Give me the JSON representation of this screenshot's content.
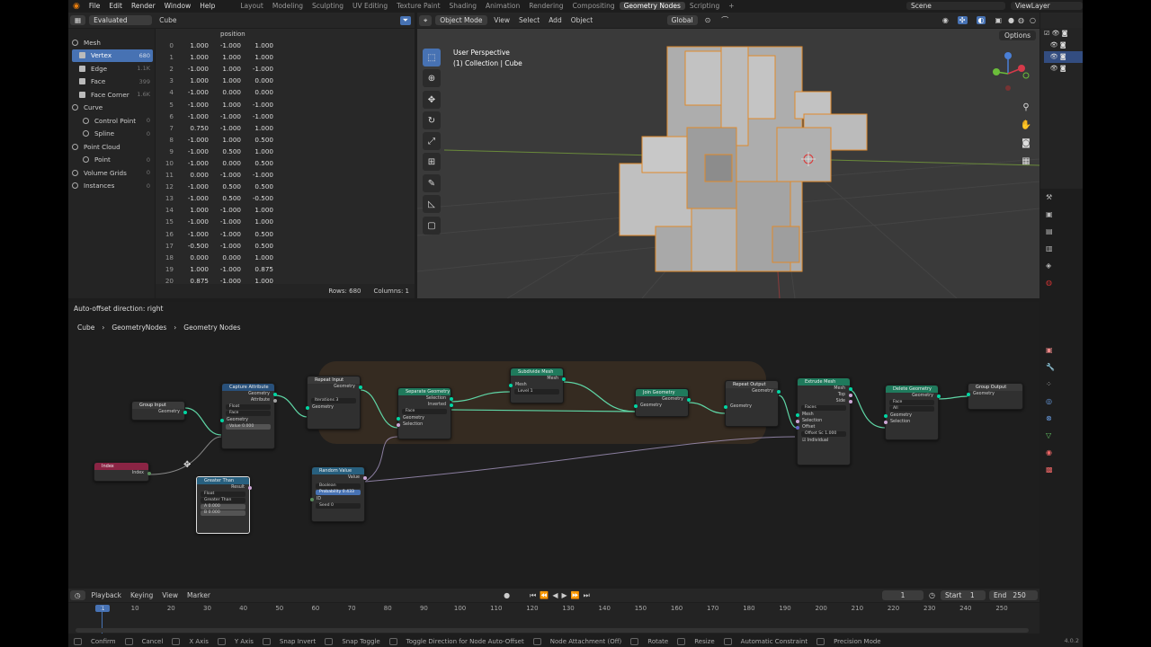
{
  "menu": {
    "items": [
      "File",
      "Edit",
      "Render",
      "Window",
      "Help"
    ],
    "workspaces": [
      "Layout",
      "Modeling",
      "Sculpting",
      "UV Editing",
      "Texture Paint",
      "Shading",
      "Animation",
      "Rendering",
      "Compositing",
      "Geometry Nodes",
      "Scripting"
    ],
    "active_workspace": "Geometry Nodes",
    "plus": "+",
    "scene": "Scene",
    "view_layer": "ViewLayer"
  },
  "spreadsheet": {
    "mode": "Evaluated",
    "object": "Cube",
    "column_header": "position",
    "tree": [
      {
        "label": "Mesh",
        "kind": "group"
      },
      {
        "label": "Vertex",
        "count": "680",
        "selected": true
      },
      {
        "label": "Edge",
        "count": "1.1K"
      },
      {
        "label": "Face",
        "count": "399"
      },
      {
        "label": "Face Corner",
        "count": "1.6K"
      },
      {
        "label": "Curve",
        "kind": "group"
      },
      {
        "label": "Control Point",
        "count": "0"
      },
      {
        "label": "Spline",
        "count": "0"
      },
      {
        "label": "Point Cloud",
        "kind": "group"
      },
      {
        "label": "Point",
        "count": "0"
      },
      {
        "label": "Volume Grids",
        "count": "0",
        "kind": "group"
      },
      {
        "label": "Instances",
        "count": "0",
        "kind": "group"
      }
    ],
    "rows": [
      [
        "0",
        "1.000",
        "-1.000",
        "1.000"
      ],
      [
        "1",
        "1.000",
        "1.000",
        "1.000"
      ],
      [
        "2",
        "-1.000",
        "1.000",
        "-1.000"
      ],
      [
        "3",
        "1.000",
        "1.000",
        "0.000"
      ],
      [
        "4",
        "-1.000",
        "0.000",
        "0.000"
      ],
      [
        "5",
        "-1.000",
        "1.000",
        "-1.000"
      ],
      [
        "6",
        "-1.000",
        "-1.000",
        "-1.000"
      ],
      [
        "7",
        "0.750",
        "-1.000",
        "1.000"
      ],
      [
        "8",
        "-1.000",
        "1.000",
        "0.500"
      ],
      [
        "9",
        "-1.000",
        "0.500",
        "1.000"
      ],
      [
        "10",
        "-1.000",
        "0.000",
        "0.500"
      ],
      [
        "11",
        "0.000",
        "-1.000",
        "-1.000"
      ],
      [
        "12",
        "-1.000",
        "0.500",
        "0.500"
      ],
      [
        "13",
        "-1.000",
        "0.500",
        "-0.500"
      ],
      [
        "14",
        "1.000",
        "-1.000",
        "1.000"
      ],
      [
        "15",
        "-1.000",
        "-1.000",
        "1.000"
      ],
      [
        "16",
        "-1.000",
        "-1.000",
        "0.500"
      ],
      [
        "17",
        "-0.500",
        "-1.000",
        "0.500"
      ],
      [
        "18",
        "0.000",
        "0.000",
        "1.000"
      ],
      [
        "19",
        "1.000",
        "-1.000",
        "0.875"
      ],
      [
        "20",
        "0.875",
        "-1.000",
        "1.000"
      ]
    ],
    "rows_label": "Rows: 680",
    "columns_label": "Columns: 1"
  },
  "viewport": {
    "mode": "Object Mode",
    "menus": [
      "View",
      "Select",
      "Add",
      "Object"
    ],
    "transform": "Global",
    "title": "User Perspective",
    "subtitle": "(1) Collection | Cube",
    "options": "Options"
  },
  "node_editor": {
    "hint": "Auto-offset direction: right",
    "breadcrumb": [
      "Cube",
      "GeometryNodes",
      "Geometry Nodes"
    ],
    "nodes": {
      "group_input": {
        "title": "Group Input",
        "out": "Geometry"
      },
      "capture": {
        "title": "Capture Attribute",
        "out1": "Geometry",
        "out2": "Attribute",
        "dtype": "Float",
        "domain": "Face",
        "in1": "Geometry",
        "in2": "Value",
        "in2_val": "0.000"
      },
      "repeat_in": {
        "title": "Repeat Input",
        "out": "Geometry",
        "iter_label": "Iterations",
        "iter_val": "3",
        "in": "Geometry"
      },
      "separate": {
        "title": "Separate Geometry",
        "out1": "Selection",
        "out2": "Inverted",
        "domain": "Face",
        "in1": "Geometry",
        "in2": "Selection"
      },
      "subdivide": {
        "title": "Subdivide Mesh",
        "out": "Mesh",
        "in": "Mesh",
        "level_label": "Level",
        "level_val": "1"
      },
      "join": {
        "title": "Join Geometry",
        "out": "Geometry",
        "in": "Geometry"
      },
      "repeat_out": {
        "title": "Repeat Output",
        "out": "Geometry",
        "in": "Geometry"
      },
      "extrude": {
        "title": "Extrude Mesh",
        "out1": "Mesh",
        "out2": "Top",
        "out3": "Side",
        "mode": "Faces",
        "in1": "Mesh",
        "in2": "Selection",
        "in3": "Offset",
        "scale_label": "Offset Sc",
        "scale_val": "1.000",
        "ind": "Individual"
      },
      "delete": {
        "title": "Delete Geometry",
        "out": "Geometry",
        "domain": "Face",
        "mode": "All",
        "in1": "Geometry",
        "in2": "Selection"
      },
      "group_output": {
        "title": "Group Output",
        "in": "Geometry"
      },
      "index": {
        "title": "Index",
        "out": "Index"
      },
      "greater": {
        "title": "Greater Than",
        "out": "Result",
        "dtype": "Float",
        "op": "Greater Than",
        "a_label": "A",
        "a_val": "0.000",
        "b_label": "B",
        "b_val": "0.000"
      },
      "random": {
        "title": "Random Value",
        "out": "Value",
        "dtype": "Boolean",
        "prob_label": "Probability",
        "prob_val": "0.433",
        "id": "ID",
        "seed_label": "Seed",
        "seed_val": "0"
      }
    }
  },
  "timeline": {
    "menus": [
      "Playback",
      "Keying",
      "View",
      "Marker"
    ],
    "current": "1",
    "start_label": "Start",
    "start": "1",
    "end_label": "End",
    "end": "250",
    "ticks": [
      "1",
      "10",
      "20",
      "30",
      "40",
      "50",
      "60",
      "70",
      "80",
      "90",
      "100",
      "110",
      "120",
      "130",
      "140",
      "150",
      "160",
      "170",
      "180",
      "190",
      "200",
      "210",
      "220",
      "230",
      "240",
      "250"
    ]
  },
  "statusbar": {
    "items": [
      "Confirm",
      "Cancel",
      "X Axis",
      "Y Axis",
      "Snap Invert",
      "Snap Toggle",
      "Toggle Direction for Node Auto-Offset",
      "Node Attachment (Off)",
      "Rotate",
      "Resize",
      "Automatic Constraint",
      "Precision Mode"
    ],
    "version": "4.0.2"
  },
  "colors": {
    "accent": "#4772b3",
    "selection_outline": "#e08a2c",
    "geometry_socket": "#00d6a3",
    "link": "#5fd6a6"
  }
}
